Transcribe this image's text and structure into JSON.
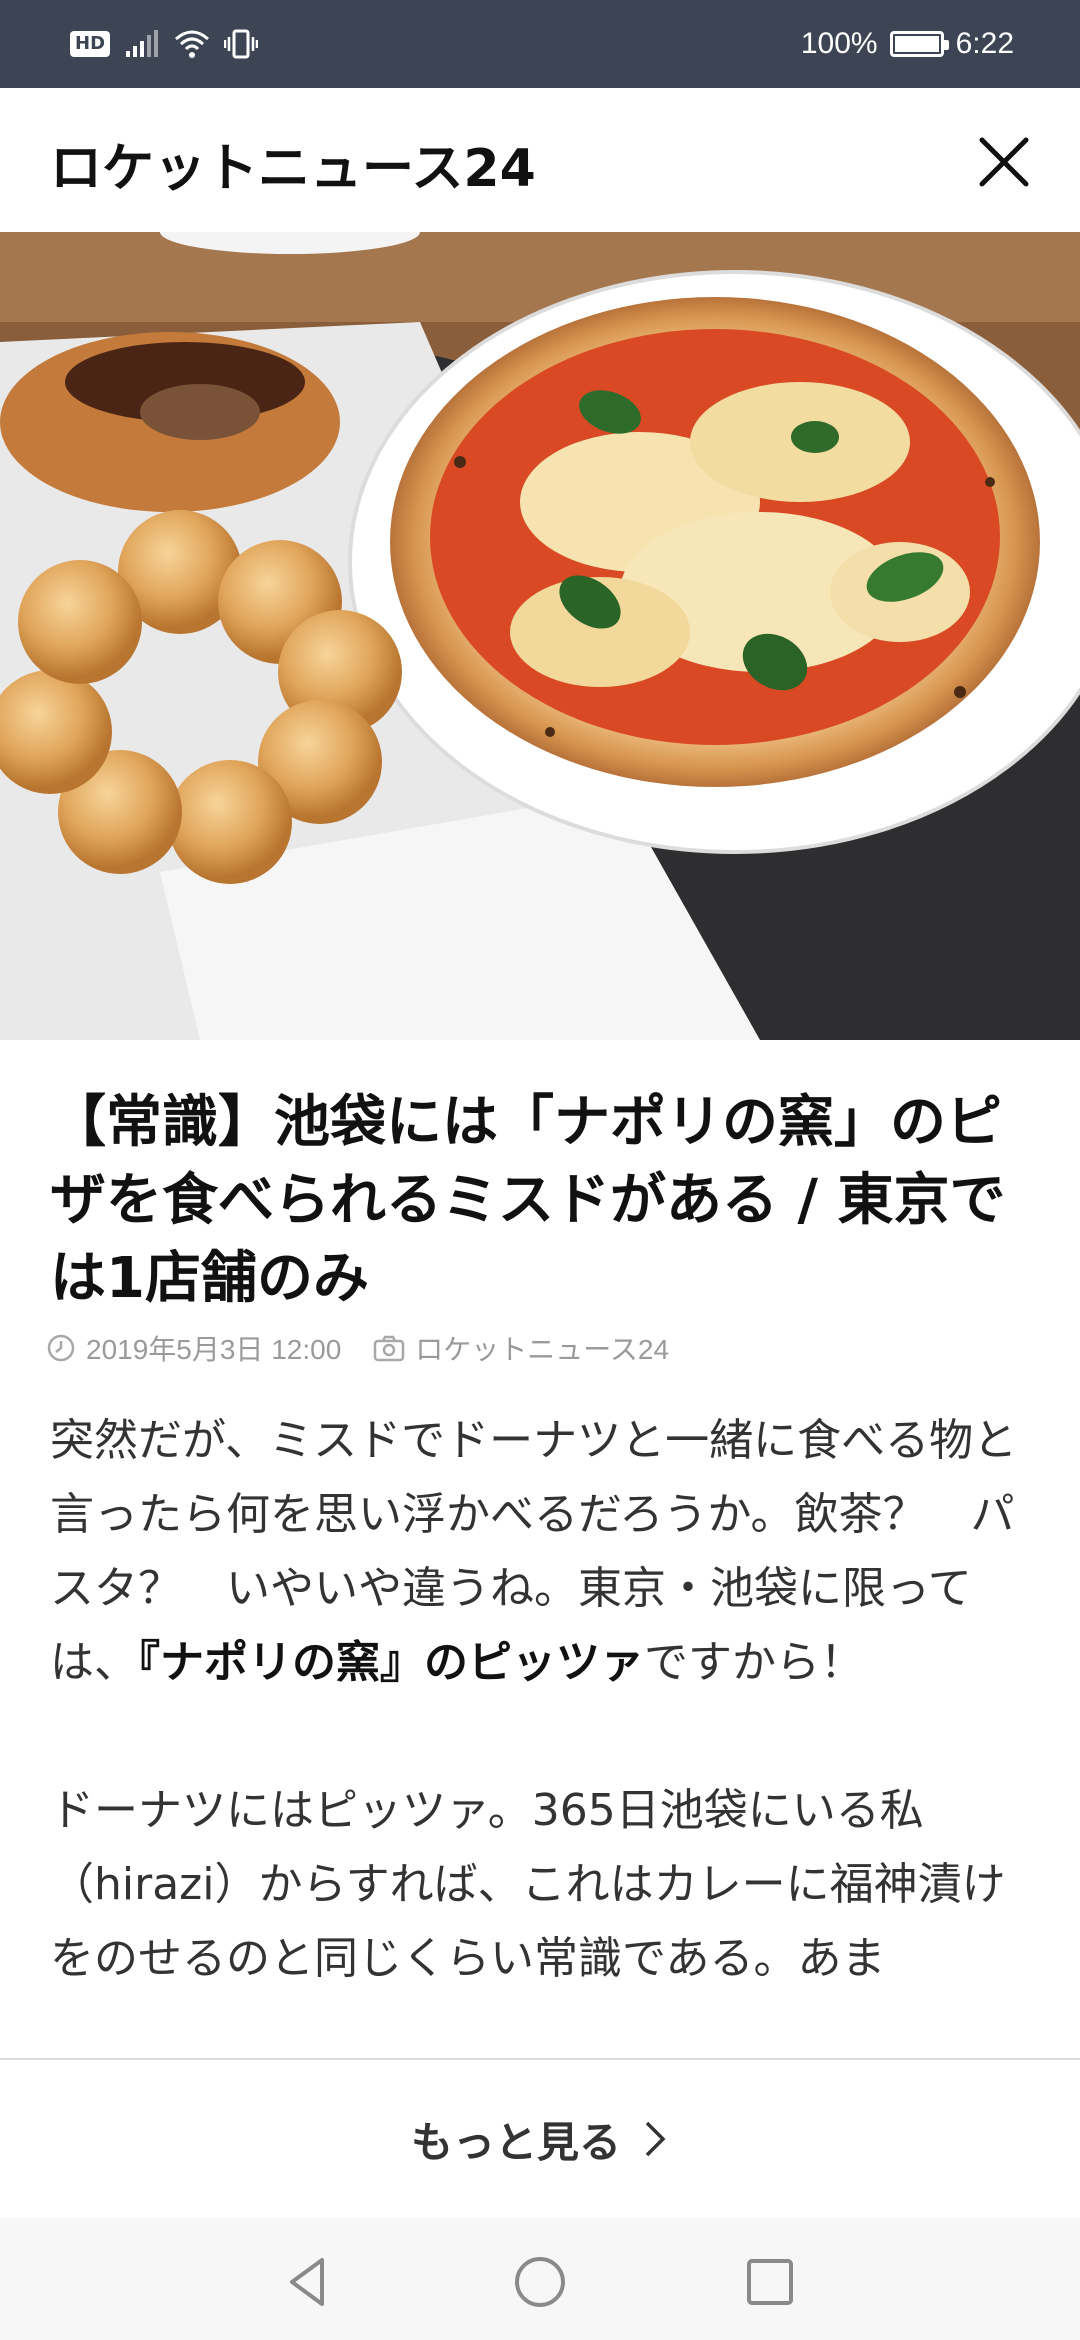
{
  "status_bar": {
    "hd": "HD",
    "battery_percent": "100%",
    "time": "6:22"
  },
  "header": {
    "title": "ロケットニュース24"
  },
  "hero_image": {
    "description_icon": "photo-pizza-and-donuts"
  },
  "article": {
    "headline": "【常識】池袋には「ナポリの窯」のピザを食べられるミスドがある / 東京では1店舗のみ",
    "date": "2019年5月3日 12:00",
    "source": "ロケットニュース24",
    "para1_a": "突然だが、ミスドでドーナツと一緒に食べる物と言ったら何を思い浮かべるだろうか。飲茶？　パスタ？　いやいや違うね。東京・池袋に限っては、",
    "para1_bold": "『ナポリの窯』のピッツァ",
    "para1_b": "ですから！",
    "para2": "ドーナツにはピッツァ。365日池袋にいる私（hirazi）からすれば、これはカレーに福神漬けをのせるのと同じくらい常識である。あま"
  },
  "more": {
    "label": "もっと見る"
  },
  "colors": {
    "statusbar": "#3d4555",
    "text": "#111111",
    "meta": "#9a9a9a"
  }
}
